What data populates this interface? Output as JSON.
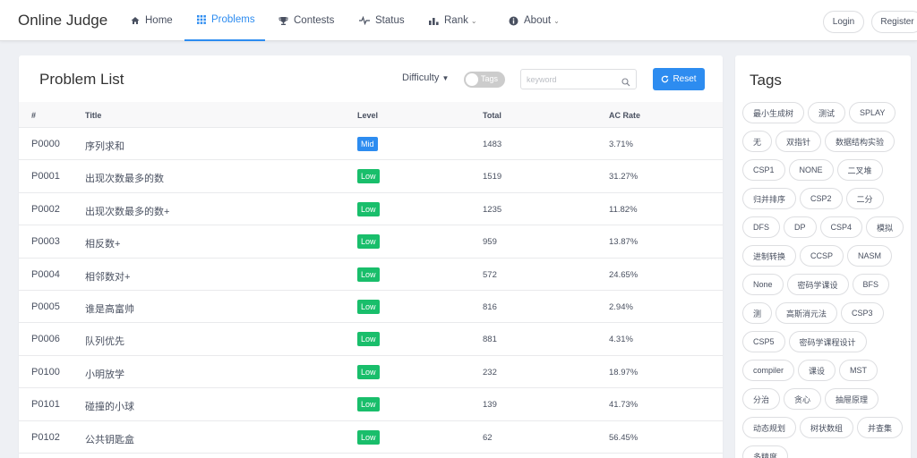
{
  "app": {
    "title": "Online Judge"
  },
  "nav": {
    "home": "Home",
    "problems": "Problems",
    "contests": "Contests",
    "status": "Status",
    "rank": "Rank",
    "about": "About"
  },
  "header": {
    "login": "Login",
    "register": "Register"
  },
  "problem_list": {
    "title": "Problem List",
    "difficulty": "Difficulty",
    "tags_toggle": "Tags",
    "search_placeholder": "keyword",
    "reset": "Reset",
    "columns": {
      "id": "#",
      "title": "Title",
      "level": "Level",
      "total": "Total",
      "ac_rate": "AC Rate"
    },
    "rows": [
      {
        "id": "P0000",
        "title": "序列求和",
        "level": "Mid",
        "total": "1483",
        "ac_rate": "3.71%"
      },
      {
        "id": "P0001",
        "title": "出现次数最多的数",
        "level": "Low",
        "total": "1519",
        "ac_rate": "31.27%"
      },
      {
        "id": "P0002",
        "title": "出现次数最多的数+",
        "level": "Low",
        "total": "1235",
        "ac_rate": "11.82%"
      },
      {
        "id": "P0003",
        "title": "相反数+",
        "level": "Low",
        "total": "959",
        "ac_rate": "13.87%"
      },
      {
        "id": "P0004",
        "title": "相邻数对+",
        "level": "Low",
        "total": "572",
        "ac_rate": "24.65%"
      },
      {
        "id": "P0005",
        "title": "谁是高富帅",
        "level": "Low",
        "total": "816",
        "ac_rate": "2.94%"
      },
      {
        "id": "P0006",
        "title": "队列优先",
        "level": "Low",
        "total": "881",
        "ac_rate": "4.31%"
      },
      {
        "id": "P0100",
        "title": "小明放学",
        "level": "Low",
        "total": "232",
        "ac_rate": "18.97%"
      },
      {
        "id": "P0101",
        "title": "碰撞的小球",
        "level": "Low",
        "total": "139",
        "ac_rate": "41.73%"
      },
      {
        "id": "P0102",
        "title": "公共钥匙盒",
        "level": "Low",
        "total": "62",
        "ac_rate": "56.45%"
      }
    ]
  },
  "tags": {
    "title": "Tags",
    "items": [
      "最小生成树",
      "测试",
      "SPLAY",
      "无",
      "双指针",
      "数据结构实验",
      "CSP1",
      "NONE",
      "二叉堆",
      "归并排序",
      "CSP2",
      "二分",
      "DFS",
      "DP",
      "CSP4",
      "模拟",
      "进制转换",
      "CCSP",
      "NASM",
      "None",
      "密码学课设",
      "BFS",
      "测",
      "高斯消元法",
      "CSP3",
      "CSP5",
      "密码学课程设计",
      "compiler",
      "课设",
      "MST",
      "分治",
      "贪心",
      "抽屉原理",
      "动态规划",
      "树状数组",
      "并查集",
      "多精度"
    ]
  },
  "colors": {
    "accent": "#2d8cf0",
    "mid_badge": "#2d8cf0",
    "low_badge": "#19be6b"
  },
  "icons": {
    "home": "home-icon",
    "problems": "grid-icon",
    "contests": "trophy-icon",
    "status": "pulse-icon",
    "rank": "bar-chart-icon",
    "about": "info-icon",
    "search": "search-icon",
    "reset": "refresh-icon"
  }
}
